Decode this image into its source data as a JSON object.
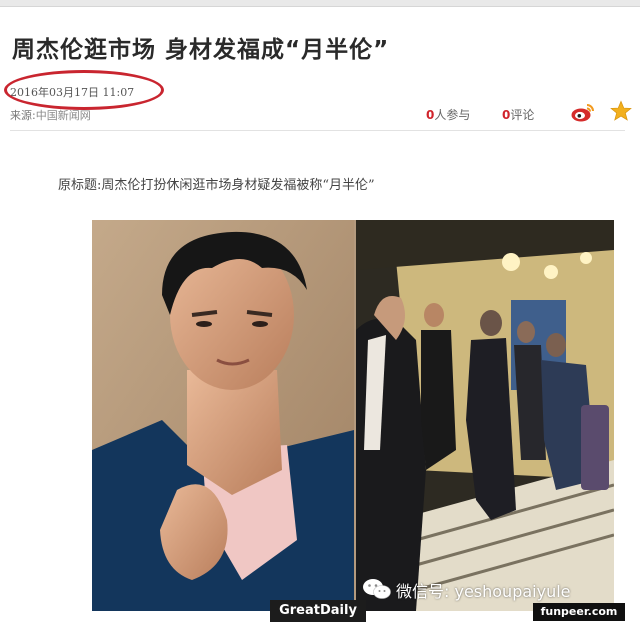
{
  "article": {
    "headline": "周杰伦逛市场  身材发福成“月半伦”",
    "date": "2016年03月17日  11:07",
    "source_label": "来源:",
    "source_name": "中国新闻网",
    "participants_count": "0",
    "participants_label": "人参与",
    "comments_count": "0",
    "comments_label": "评论",
    "original_title": "原标题:周杰伦打扮休闲逛市场身材疑发福被称“月半伦”"
  },
  "icons": {
    "share": "weibo-icon",
    "favorite": "star-icon",
    "watermark": "wechat-icon"
  },
  "overlay": {
    "wechat_text": "微信号: yeshoupaiyule",
    "badge_left": "GreatDaily",
    "badge_right": "funpeer.com"
  },
  "colors": {
    "highlight_circle": "#c9252f",
    "count_red": "#d0242c",
    "star": "#f2b01e"
  }
}
